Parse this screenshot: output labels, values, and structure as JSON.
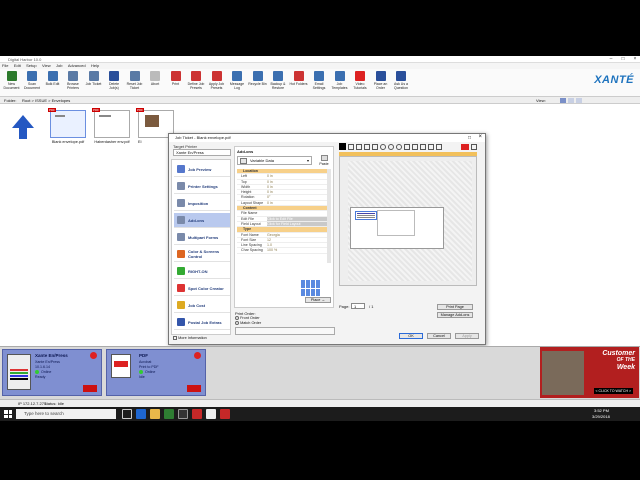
{
  "window": {
    "title": "Digital Harbor 10.0"
  },
  "menu": [
    "File",
    "Edit",
    "Setup",
    "View",
    "Job",
    "Advanced",
    "Help"
  ],
  "toolbar": [
    {
      "label": "New Document",
      "color": "#2c7a2c",
      "icon": "new-document-icon"
    },
    {
      "label": "Scan Document",
      "color": "#3b6fb0",
      "icon": "scan-icon"
    },
    {
      "label": "Bulk Edit",
      "color": "#3b6fb0",
      "icon": "bulk-edit-icon"
    },
    {
      "label": "Browse Printers",
      "color": "#5a7aa5",
      "icon": "printer-icon"
    },
    {
      "label": "Job Ticket",
      "color": "#5a7aa5",
      "icon": "ticket-icon"
    },
    {
      "label": "Delete Job(s)",
      "color": "#2a4f9a",
      "icon": "delete-icon"
    },
    {
      "label": "Reset Job Ticket",
      "color": "#5a7aa5",
      "icon": "reset-icon"
    },
    {
      "label": "Abort",
      "color": "#bbbbbb",
      "icon": "abort-icon"
    },
    {
      "label": "Print",
      "color": "#cc3333",
      "icon": "print-icon"
    },
    {
      "label": "Define Job Presets",
      "color": "#cc3333",
      "icon": "define-preset-icon"
    },
    {
      "label": "Apply Job Presets",
      "color": "#cc3333",
      "icon": "apply-preset-icon"
    },
    {
      "label": "Message Log",
      "color": "#3b6fb0",
      "icon": "log-icon"
    },
    {
      "label": "Recycle Bin",
      "color": "#3b6fb0",
      "icon": "recycle-icon"
    },
    {
      "label": "Backup & Restore",
      "color": "#3b6fb0",
      "icon": "backup-icon"
    },
    {
      "label": "Hot Folders",
      "color": "#cc3333",
      "icon": "folder-icon"
    },
    {
      "label": "Email Settings",
      "color": "#3b6fb0",
      "icon": "email-icon"
    },
    {
      "label": "Job Templates",
      "color": "#3b6fb0",
      "icon": "template-icon"
    },
    {
      "label": "Video Tutorials",
      "color": "#dd2222",
      "icon": "video-icon"
    },
    {
      "label": "Place an Order",
      "color": "#2a4f9a",
      "icon": "order-icon"
    },
    {
      "label": "Ask Us a Question",
      "color": "#2a4f9a",
      "icon": "question-icon"
    }
  ],
  "brand": "XANTÉ",
  "path": {
    "folder_label": "Folder:",
    "root": "Root > ISSUE > Envelopes",
    "view_label": "View:"
  },
  "documents": [
    {
      "name": "Blank envelope.pdf"
    },
    {
      "name": "Haberdasher env.pdf"
    },
    {
      "name": "EI"
    }
  ],
  "dialog": {
    "title": "Job Ticket - Blank envelope.pdf",
    "target_label": "Target Printer",
    "target_value": "Xante En/Press",
    "nav": [
      {
        "label": "Job Preview",
        "color": "#5577cc"
      },
      {
        "label": "Printer Settings",
        "color": "#7a8aaa"
      },
      {
        "label": "Imposition",
        "color": "#7a8aaa"
      },
      {
        "label": "Add-ons",
        "color": "#7a8aaa"
      },
      {
        "label": "Multipart Forms",
        "color": "#7a8aaa"
      },
      {
        "label": "Color & Screens Control",
        "color": "#dd6622"
      },
      {
        "label": "RIGHT-ON",
        "color": "#33aa33"
      },
      {
        "label": "Spot Color Creator",
        "color": "#dd3333"
      },
      {
        "label": "Job Cost",
        "color": "#ddaa22"
      },
      {
        "label": "Postal Job Extras",
        "color": "#3355aa"
      }
    ],
    "more_info": "More Information",
    "addons_label": "Add-ons",
    "addon_select": "Variable Data",
    "paste_label": "Paste",
    "props": [
      {
        "k": "Location",
        "v": "",
        "sec": true
      },
      {
        "k": "Left",
        "v": "0 in"
      },
      {
        "k": "Top",
        "v": "0 in"
      },
      {
        "k": "Width",
        "v": "0 in"
      },
      {
        "k": "Height",
        "v": "0 in"
      },
      {
        "k": "Rotation",
        "v": "0°"
      },
      {
        "k": "Layout Shape",
        "v": "0 in"
      },
      {
        "k": "Content",
        "v": "",
        "sec": true
      },
      {
        "k": "File Name",
        "v": ""
      },
      {
        "k": "Edit File",
        "v": "Click to Edit File"
      },
      {
        "k": "Field Layout",
        "v": "Click for Field Layout"
      },
      {
        "k": "Type",
        "v": "",
        "sec": true
      },
      {
        "k": "Font Name",
        "v": "Georgia"
      },
      {
        "k": "Font Size",
        "v": "12"
      },
      {
        "k": "Line Spacing",
        "v": "1.0"
      },
      {
        "k": "Char Spacing",
        "v": "100 %"
      }
    ],
    "place_button": "Place →",
    "print_order_label": "Print Order:",
    "print_order_options": [
      "Front Order",
      "Match Order"
    ],
    "page_label": "Page:",
    "page_value": "1",
    "page_total": "/ 1",
    "print_page_button": "Print Page",
    "manage_addons_button": "Manage Add-ons",
    "ok": "OK",
    "cancel": "Cancel",
    "apply": "Apply"
  },
  "printers": [
    {
      "name": "Xante En/Press",
      "line1": "Xante En/Press",
      "line2": "10.1.6.14",
      "status": "Online",
      "state": "Ready"
    },
    {
      "name": "PDF",
      "line1": "Acrobat",
      "line2": "Print to PDF",
      "status": "Online",
      "state": "Idle"
    }
  ],
  "ad": {
    "line1": "Customer",
    "line2": "OF THE",
    "line3": "Week",
    "cta": "< CLICK TO WATCH >"
  },
  "status": {
    "ip": "IP 172.12.7.271",
    "text": "Status: Idle"
  },
  "taskbar": {
    "search_placeholder": "Type here to search",
    "time": "3:52 PM",
    "date": "3/29/2018"
  }
}
